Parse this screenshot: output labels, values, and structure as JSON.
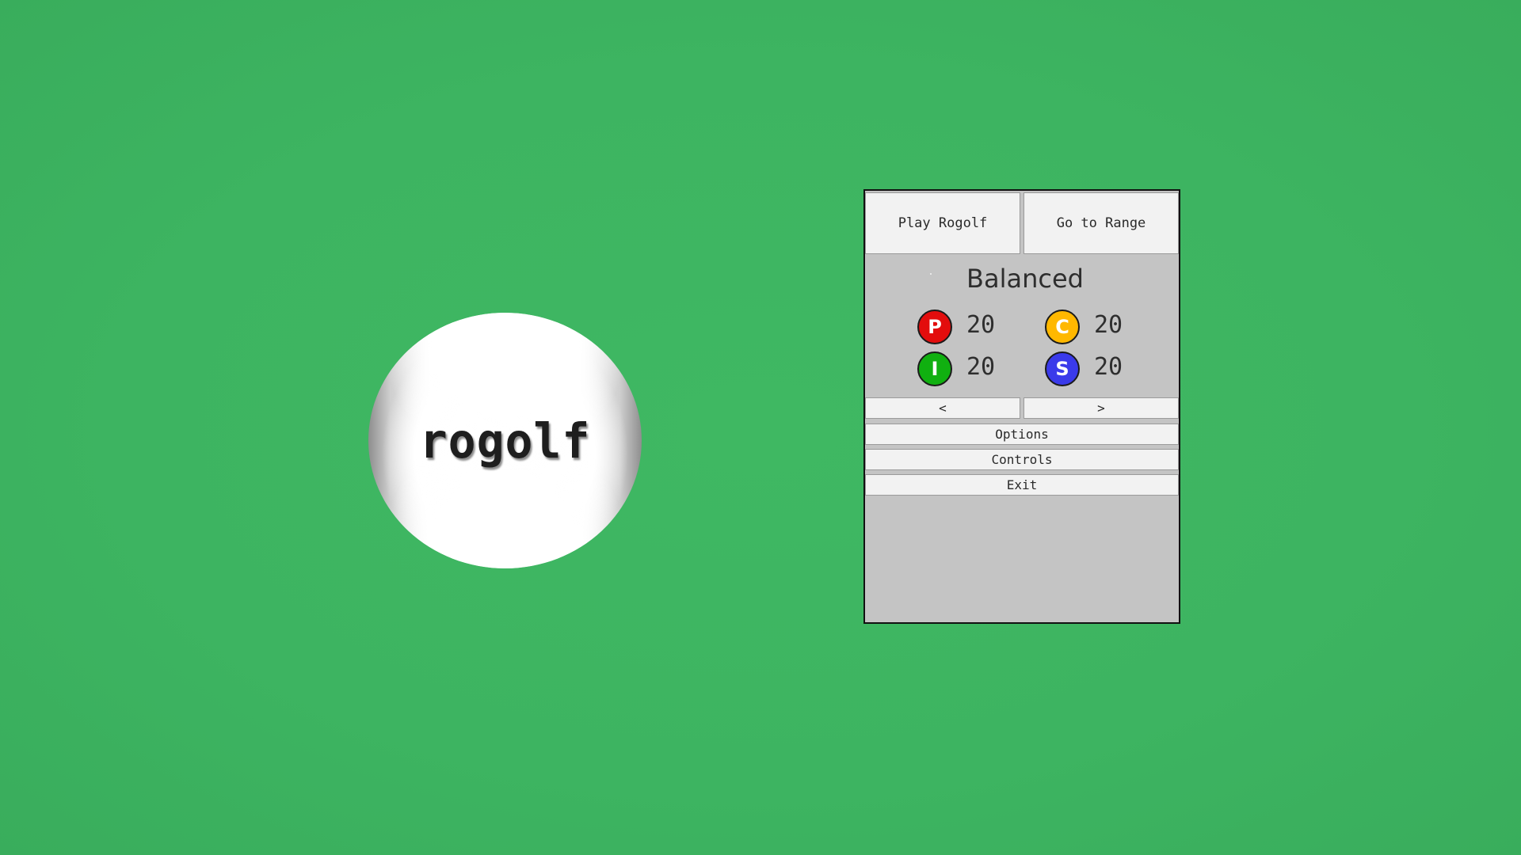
{
  "logo": {
    "text": "rogolf"
  },
  "menu": {
    "play_label": "Play Rogolf",
    "range_label": "Go to Range",
    "profile_name": "Balanced",
    "stats": [
      {
        "letter": "P",
        "value": "20",
        "color": "#e30d0d",
        "text_color": "#ffffff"
      },
      {
        "letter": "C",
        "value": "20",
        "color": "#ffb800",
        "text_color": "#ffffff"
      },
      {
        "letter": "I",
        "value": "20",
        "color": "#10b010",
        "text_color": "#ffffff"
      },
      {
        "letter": "S",
        "value": "20",
        "color": "#3a3aea",
        "text_color": "#ffffff"
      }
    ],
    "prev_label": "<",
    "next_label": ">",
    "options_label": "Options",
    "controls_label": "Controls",
    "exit_label": "Exit"
  },
  "colors": {
    "background": "#3db461",
    "panel": "#c4c4c4",
    "button": "#f2f2f2"
  }
}
